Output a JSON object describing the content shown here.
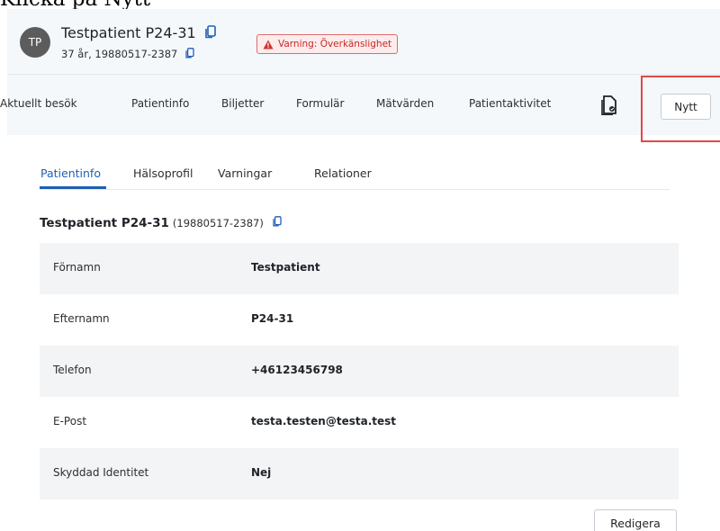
{
  "instruction": "Klicka på Nytt",
  "patient": {
    "initials": "TP",
    "name": "Testpatient P24-31",
    "details": "37 år, 19880517-2387",
    "warning": "Varning: Överkänslighet"
  },
  "nav": {
    "items": [
      {
        "label": "Aktuellt besök"
      },
      {
        "label": "Patientinfo"
      },
      {
        "label": "Biljetter"
      },
      {
        "label": "Formulär"
      },
      {
        "label": "Mätvärden"
      },
      {
        "label": "Patientaktivitet"
      }
    ],
    "new_label": "Nytt"
  },
  "tabs": [
    {
      "label": "Patientinfo",
      "active": true
    },
    {
      "label": "Hälsoprofil"
    },
    {
      "label": "Varningar"
    },
    {
      "label": "Relationer"
    }
  ],
  "section": {
    "title": "Testpatient P24-31",
    "ssn": "(19880517-2387)"
  },
  "info_rows": [
    {
      "label": "Förnamn",
      "value": "Testpatient"
    },
    {
      "label": "Efternamn",
      "value": "P24-31"
    },
    {
      "label": "Telefon",
      "value": "+46123456798"
    },
    {
      "label": "E-Post",
      "value": "testa.testen@testa.test"
    },
    {
      "label": "Skyddad Identitet",
      "value": "Nej"
    }
  ],
  "edit_label": "Redigera",
  "colors": {
    "accent": "#1f5fb5",
    "warning": "#c62828",
    "highlight": "#e04848"
  }
}
